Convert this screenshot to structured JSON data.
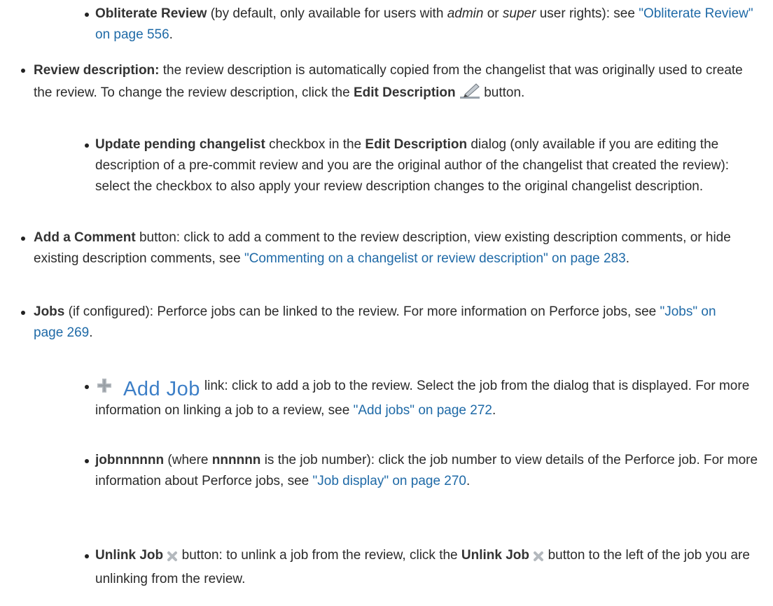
{
  "obliterate": {
    "title": "Obliterate Review",
    "t1": " (by default, only available for users with ",
    "admin": "admin",
    "t2": " or ",
    "super": "super",
    "t3": " user rights): see ",
    "link": "\"Obliterate Review\" on page 556",
    "end": "."
  },
  "review_description": {
    "title": "Review description:",
    "text": " the review description is automatically copied from the changelist that was originally used to create the review. To change the review description, click the ",
    "edit_bold": "Edit Description",
    "after_icon": " button."
  },
  "update_pending": {
    "title": "Update pending changelist",
    "t1": " checkbox in the ",
    "dialog": "Edit Description",
    "t2": " dialog (only available if you are editing the description of a pre-commit review and you are the original author of the changelist that created the review): select the checkbox to also apply your review description changes to the original changelist description."
  },
  "add_comment": {
    "title": "Add a Comment",
    "text": " button: click to add a comment to the review description, view existing description comments, or hide existing description comments, see ",
    "link": "\"Commenting on a changelist or review description\" on page 283",
    "end": "."
  },
  "jobs": {
    "title": "Jobs",
    "text": " (if configured): Perforce jobs can be linked to the review. For more information on Perforce jobs, see ",
    "link": "\"Jobs\" on page 269",
    "end": "."
  },
  "add_job": {
    "icon_label": "Add Job",
    "text": "link: click to add a job to the review. Select the job from the dialog that is displayed. For more information on linking a job to a review, see ",
    "link": "\"Add jobs\" on page 272",
    "end": "."
  },
  "jobnnn": {
    "title": "jobnnnnnn",
    "t1": " (where ",
    "nnn": "nnnnnn",
    "t2": " is the job number): click the job number to view details of the Perforce job. For more information about Perforce jobs, see ",
    "link": "\"Job display\" on page 270",
    "end": "."
  },
  "unlink": {
    "title": "Unlink Job",
    "t1": " button: to unlink a job from the review, click the ",
    "title2": "Unlink Job",
    "t2": " button to the left of the job you are unlinking from the review."
  },
  "colors": {
    "link": "#1f6aa7",
    "text": "#2b2b2b",
    "addjob": "#3d7fc7"
  },
  "icons": [
    "pencil-icon",
    "plus-icon",
    "close-x-icon"
  ]
}
